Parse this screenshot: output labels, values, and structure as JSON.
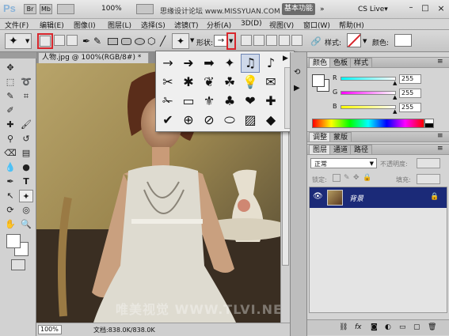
{
  "app": {
    "logo": "Ps",
    "zoom": "100%",
    "workspace_button": "基本功能",
    "cs_live": "CS Live▾",
    "watermark_top": "思缘设计论坛 www.MISSYUAN.COM"
  },
  "menu": [
    "文件(F)",
    "编辑(E)",
    "图像(I)",
    "图层(L)",
    "选择(S)",
    "滤镜(T)",
    "分析(A)",
    "3D(D)",
    "视图(V)",
    "窗口(W)",
    "帮助(H)"
  ],
  "options": {
    "shape_label": "形状:",
    "style_label": "样式:",
    "color_label": "颜色:"
  },
  "document": {
    "tab_title": "人物.jpg @ 100%(RGB/8#) *",
    "zoom_field": "100%",
    "doc_info": "文档:838.0K/838.0K",
    "watermark": "唯美视觉 WWW.TLVI.NET"
  },
  "shape_picker": {
    "shapes": [
      "→",
      "➜",
      "➡",
      "✦",
      "♫",
      "♪",
      "✂",
      "✱",
      "❦",
      "☘",
      "💡",
      "✉",
      "✁",
      "▭",
      "⚜",
      "♣",
      "❤",
      "✚",
      "✔",
      "⊕",
      "⊘",
      "⬭",
      "▨",
      "◆"
    ]
  },
  "color_panel": {
    "tabs": [
      "颜色",
      "色板",
      "样式"
    ],
    "channels": [
      {
        "label": "R",
        "value": "255"
      },
      {
        "label": "G",
        "value": "255"
      },
      {
        "label": "B",
        "value": "255"
      }
    ]
  },
  "adjust_panel": {
    "tabs": [
      "调整",
      "蒙版"
    ]
  },
  "layers_panel": {
    "tabs": [
      "图层",
      "通道",
      "路径"
    ],
    "blend_mode": "正常",
    "opacity_label": "不透明度:",
    "lock_label": "锁定:",
    "fill_label": "填充:",
    "layers": [
      {
        "name": "背景"
      }
    ]
  },
  "colors": {
    "accent_red": "#d8262c",
    "layer_selected": "#1b2a78"
  }
}
